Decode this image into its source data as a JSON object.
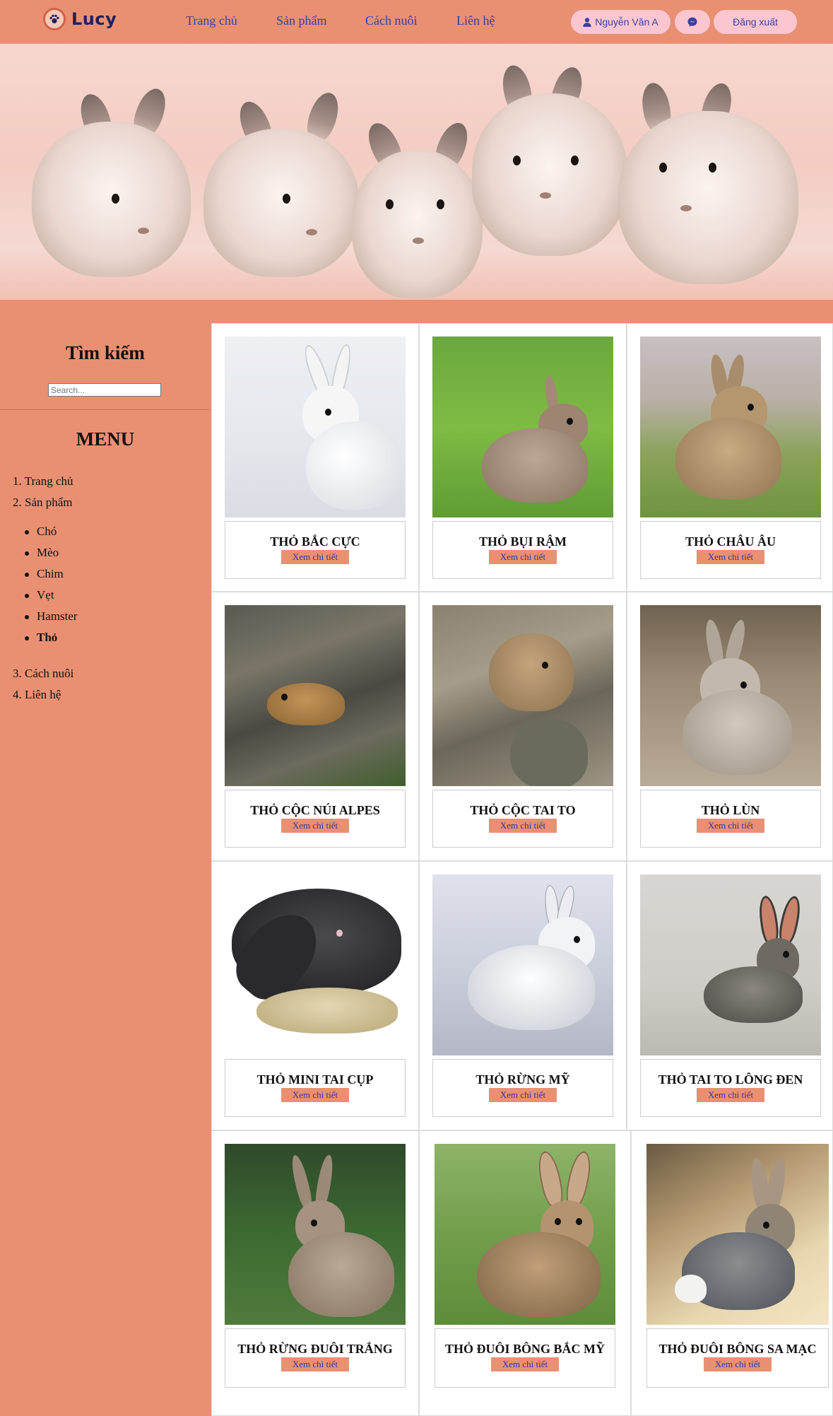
{
  "header": {
    "brand": "Lucy",
    "nav": [
      "Trang chủ",
      "Sản phẩm",
      "Cách nuôi",
      "Liên hệ"
    ],
    "user_name": "Nguyễn Văn A",
    "logout_label": "Đăng xuất",
    "icons": {
      "logo": "paw-icon",
      "user": "user-icon",
      "messenger": "messenger-icon"
    }
  },
  "sidebar": {
    "search_title": "Tìm kiếm",
    "search_placeholder": "Search...",
    "menu_title": "MENU",
    "menu": [
      {
        "num": "1.",
        "label": "Trang chủ"
      },
      {
        "num": "2.",
        "label": "Sản phẩm"
      },
      {
        "num": "3.",
        "label": "Cách nuôi"
      },
      {
        "num": "4.",
        "label": "Liên hệ"
      }
    ],
    "submenu": [
      "Chó",
      "Mèo",
      "Chim",
      "Vẹt",
      "Hamster",
      "Thỏ"
    ],
    "active_submenu": "Thỏ"
  },
  "products": {
    "detail_label": "Xem chi tiết",
    "items": [
      {
        "name": "THỎ BẮC CỰC"
      },
      {
        "name": "THỎ BỤI RẬM"
      },
      {
        "name": "THỎ CHÂU ÂU"
      },
      {
        "name": "THỎ CỘC NÚI ALPES"
      },
      {
        "name": "THỎ CỘC TAI TO"
      },
      {
        "name": "THỎ LÙN"
      },
      {
        "name": "THỎ MINI TAI CỤP"
      },
      {
        "name": "THỎ RỪNG MỸ"
      },
      {
        "name": "THỎ TAI TO LÔNG ĐEN"
      },
      {
        "name": "THỎ RỪNG ĐUÔI TRẮNG"
      },
      {
        "name": "THỎ ĐUÔI BÔNG BẮC MỸ"
      },
      {
        "name": "THỎ ĐUÔI BÔNG SA MẠC"
      }
    ]
  },
  "colors": {
    "primary": "#e99073",
    "pill": "#fbc6cf",
    "link": "#3a3f9b"
  }
}
